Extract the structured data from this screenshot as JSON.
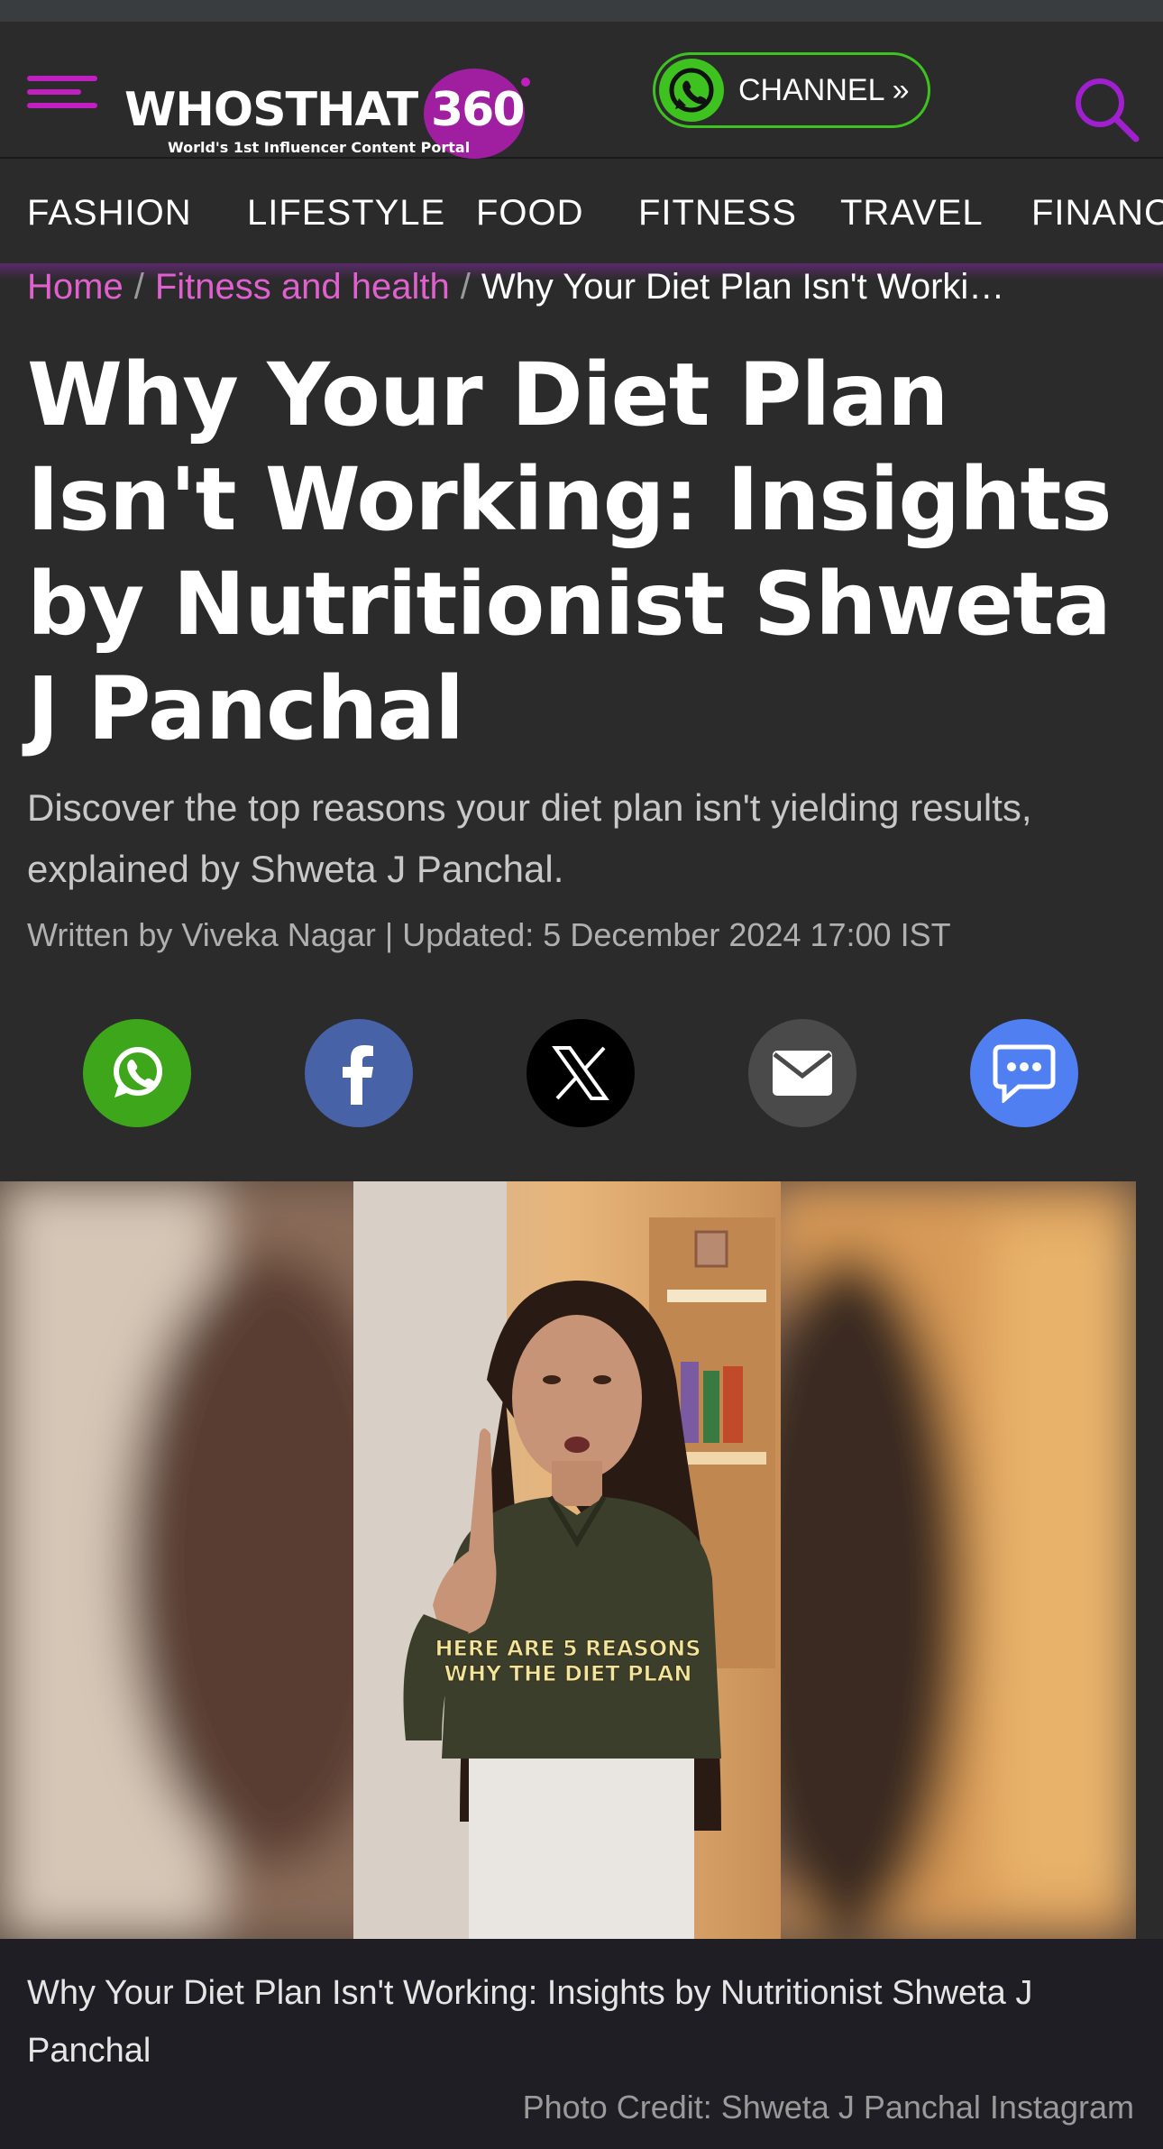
{
  "header": {
    "logo_text": "WHOSTHAT",
    "logo_number": "360",
    "logo_tagline": "World's 1st Influencer Content Portal",
    "channel_label": "CHANNEL »"
  },
  "nav": {
    "items": [
      "FASHION",
      "LIFESTYLE",
      "FOOD",
      "FITNESS",
      "TRAVEL",
      "FINANC"
    ]
  },
  "breadcrumb": {
    "home": "Home",
    "sep1": "/",
    "category": "Fitness and health",
    "sep2": "/",
    "current": "Why Your Diet Plan Isn't Worki…"
  },
  "article": {
    "title": "Why Your Diet Plan Isn't Working: Insights by Nutritionist Shweta J Panchal",
    "subtitle": "Discover the top reasons your diet plan isn't yielding results, explained by Shweta J Panchal.",
    "byline": "Written by Viveka Nagar | Updated: 5 December 2024 17:00 IST"
  },
  "share": {
    "icons": [
      "whatsapp-icon",
      "facebook-icon",
      "x-icon",
      "email-icon",
      "sms-icon"
    ],
    "colors": {
      "whatsapp": "#3ea61a",
      "facebook": "#4862a8",
      "x": "#000000",
      "email": "#4a4a4a",
      "sms": "#4f7ff0"
    }
  },
  "hero": {
    "overlay_text_1": "HERE ARE 5 REASONS",
    "overlay_text_2": "WHY THE DIET PLAN"
  },
  "caption": {
    "text": "Why Your Diet Plan Isn't Working: Insights by Nutritionist Shweta J Panchal",
    "credit": "Photo Credit: Shweta J Panchal Instagram"
  },
  "colors": {
    "accent": "#c020c0",
    "whatsapp_green": "#3ec21f",
    "background": "#2b2b2b"
  }
}
